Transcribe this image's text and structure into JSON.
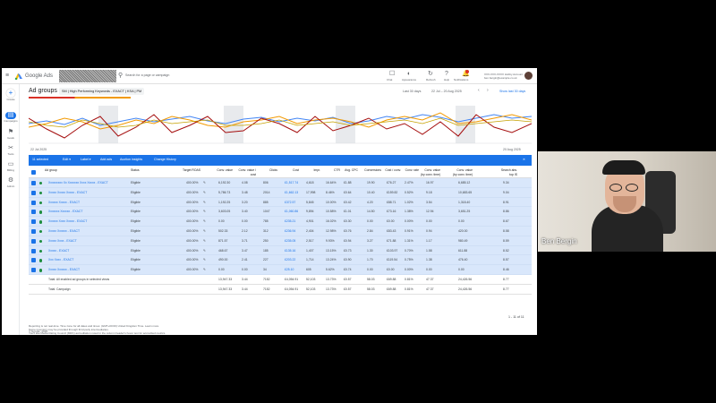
{
  "app": {
    "logo_text": "Google Ads",
    "search_placeholder": "Search for a page or campaign"
  },
  "topbar": {
    "actions": [
      "Chat",
      "Appearance",
      "Refresh",
      "Help",
      "Notifications"
    ],
    "account": {
      "line1": "XXX-XXX-XXXX Hobby Account",
      "line2": "ben.bergin@example.co.uk"
    }
  },
  "sidebar": [
    {
      "label": "Create"
    },
    {
      "label": "Campaigns"
    },
    {
      "label": "Goals"
    },
    {
      "label": "Tools"
    },
    {
      "label": "Billing"
    },
    {
      "label": "Admin"
    }
  ],
  "page": {
    "title": "Ad groups",
    "filter_chip": "SM | High Performing Keywords - EXACT | KSA | PM",
    "date_range": "Last 30 days",
    "date_span": "22 Jul – 20 Aug 2025",
    "show_last": "Show last 30 days"
  },
  "chart_meta": {
    "start_label": "22 Jul 2025",
    "end_label": "20 Aug 2025"
  },
  "toolbar": {
    "selected": "11 selected",
    "items": [
      "Edit ▾",
      "Label ▾",
      "Add ads",
      "Auction insights",
      "Change History"
    ],
    "close": "✕"
  },
  "table": {
    "headers": [
      "Ad group",
      "Status",
      "Target ROAS",
      "Conv. value",
      "Conv. value / cost",
      "Clicks",
      "Cost",
      "Impr.",
      "CTR",
      "Avg. CPC",
      "Conversions",
      "Cost / conv.",
      "Conv. rate",
      "Conv. value (by conv. time)",
      "Conv. value (by conv. time)",
      "Search abs. top IS"
    ],
    "rows": [
      {
        "name": "Xxxxxxxxx Xx Xxxxxxx Xxxx Xxxxx - EXACT",
        "status": "Eligible",
        "troas": "400.00%",
        "v": [
          "6,192.30",
          "4.08",
          "806",
          "£1,517.74",
          "4,618",
          "16.64%",
          "£1.88",
          "19.90",
          "£76.27",
          "2.47%",
          "16.97",
          "6,685.12",
          "9.34"
        ]
      },
      {
        "name": "Xxxxx Xxxxx Xxxxx - EXACT",
        "status": "Eligible",
        "troas": "400.00%",
        "v": [
          "5,786.73",
          "3.48",
          "2014",
          "£1,662.13",
          "17,998",
          "8.46%",
          "£0.64",
          "10.40",
          "£159.82",
          "0.52%",
          "9.18",
          "10,683.65",
          "9.04"
        ]
      },
      {
        "name": "Xxxxxx Xxxxx - EXACT",
        "status": "Eligible",
        "troas": "400.00%",
        "v": [
          "1,192.25",
          "3.20",
          "885",
          "£372.57",
          "5,845",
          "10.00%",
          "£0.42",
          "4.20",
          "£88.71",
          "1.02%",
          "3.54",
          "1,318.40",
          "8.91"
        ]
      },
      {
        "name": "Xxxxxxx Xxxxxx - EXACT",
        "status": "Eligible",
        "troas": "400.00%",
        "v": [
          "3,603.05",
          "3.40",
          "1047",
          "£1,060.86",
          "9,894",
          "10.58%",
          "£1.01",
          "14.50",
          "£73.16",
          "1.38%",
          "12.94",
          "3,651.25",
          "8.86"
        ]
      },
      {
        "name": "Xxxxxx Xxxx Xxxxx - EXACT",
        "status": "Eligible",
        "troas": "400.00%",
        "v": [
          "0.00",
          "0.00",
          "785",
          "£235.21",
          "4,901",
          "16.02%",
          "£0.30",
          "0.00",
          "£0.00",
          "0.00%",
          "0.00",
          "0.00",
          "8.67"
        ]
      },
      {
        "name": "Xxxxx Xxxxxx - EXACT",
        "status": "Eligible",
        "troas": "400.00%",
        "v": [
          "502.33",
          "2.12",
          "312",
          "£236.94",
          "2,404",
          "12.98%",
          "£0.76",
          "2.84",
          "£83.43",
          "0.91%",
          "0.94",
          "420.00",
          "8.58"
        ]
      },
      {
        "name": "Xxxxx Xxxx - EXACT",
        "status": "Eligible",
        "troas": "400.00%",
        "v": [
          "871.57",
          "3.71",
          "250",
          "£235.05",
          "2,517",
          "9.93%",
          "£0.94",
          "3.27",
          "£71.88",
          "1.31%",
          "1.17",
          "980.49",
          "8.59"
        ]
      },
      {
        "name": "Xxxxx - EXACT",
        "status": "Eligible",
        "troas": "400.00%",
        "v": [
          "468.67",
          "3.47",
          "185",
          "£135.16",
          "1,407",
          "13.15%",
          "£0.73",
          "1.30",
          "£103.97",
          "0.70%",
          "1.58",
          "611.88",
          "8.52"
        ]
      },
      {
        "name": "Xxx Xxxx - EXACT",
        "status": "Eligible",
        "troas": "400.00%",
        "v": [
          "490.00",
          "2.41",
          "227",
          "£203.22",
          "1,714",
          "13.24%",
          "£0.90",
          "1.70",
          "£119.54",
          "0.75%",
          "1.38",
          "476.40",
          "8.57"
        ]
      },
      {
        "name": "Xxxxx Xxxxxx - EXACT",
        "status": "Eligible",
        "troas": "400.00%",
        "v": [
          "0.00",
          "0.00",
          "34",
          "£25.10",
          "605",
          "5.62%",
          "£0.74",
          "0.00",
          "£0.00",
          "0.00%",
          "0.00",
          "0.00",
          "8.46"
        ]
      }
    ],
    "totals": [
      {
        "name": "Total: All enabled ad groups in selected views",
        "v": [
          "13,947.33",
          "3.44",
          "7152",
          "£4,054.91",
          "52,103",
          "13.73%",
          "£0.57",
          "58.03",
          "£69.88",
          "0.81%",
          "47.37",
          "24,426.56",
          "8.77"
        ]
      },
      {
        "name": "Total: Campaign",
        "v": [
          "13,947.33",
          "3.44",
          "7152",
          "£4,054.91",
          "52,103",
          "13.73%",
          "£0.57",
          "58.03",
          "£69.88",
          "0.81%",
          "47.37",
          "24,426.56",
          "8.77"
        ]
      }
    ],
    "pager": "1 - 11 of 11"
  },
  "footer": {
    "lines": [
      "Reporting is not real-time. Time zone for all dates and times: (GMT+00:00) United Kingdom Time. Learn more",
      "Some inventory may be provided through third party intermediaries.",
      "You'll see Media Rating Council (MRC) accreditation noted in the column header's hover text for accredited metrics.",
      "© Google, 2025."
    ]
  },
  "webcam": {
    "name": "Ben Bergin"
  }
}
